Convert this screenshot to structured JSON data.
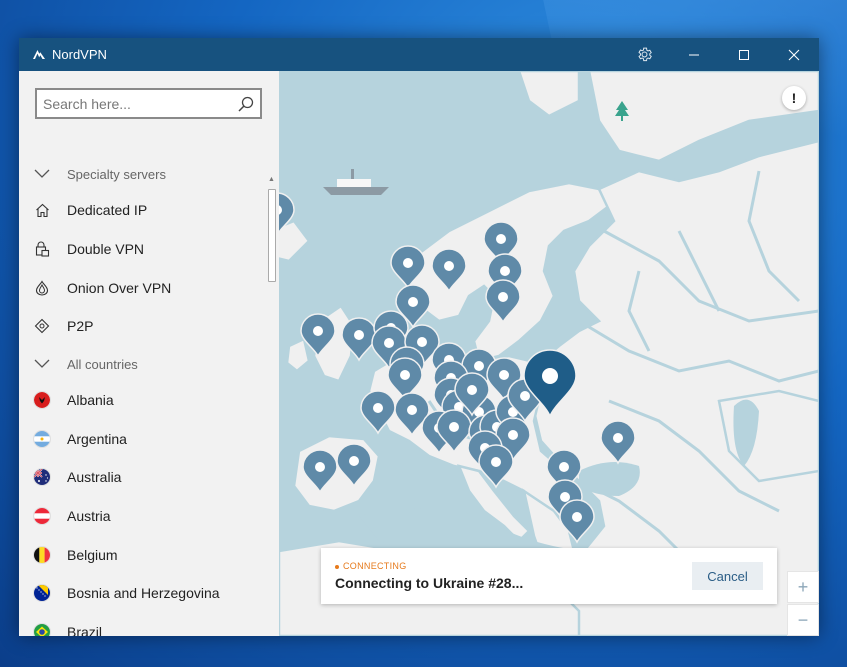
{
  "window": {
    "title": "NordVPN"
  },
  "titlebar": {
    "settings_icon": "gear-icon",
    "minimize_icon": "minimize-icon",
    "maximize_icon": "maximize-icon",
    "close_icon": "close-icon"
  },
  "search": {
    "placeholder": "Search here...",
    "value": ""
  },
  "sidebar": {
    "items": [
      {
        "label": "Specialty servers",
        "icon": "chevron-down-icon",
        "type": "header"
      },
      {
        "label": "Dedicated IP",
        "icon": "home-icon",
        "type": "item"
      },
      {
        "label": "Double VPN",
        "icon": "double-lock-icon",
        "type": "item"
      },
      {
        "label": "Onion Over VPN",
        "icon": "onion-icon",
        "type": "item"
      },
      {
        "label": "P2P",
        "icon": "p2p-icon",
        "type": "item"
      },
      {
        "label": "All countries",
        "icon": "chevron-down-icon",
        "type": "header"
      },
      {
        "label": "Albania",
        "icon": "flag-albania-icon",
        "type": "country"
      },
      {
        "label": "Argentina",
        "icon": "flag-argentina-icon",
        "type": "country"
      },
      {
        "label": "Australia",
        "icon": "flag-australia-icon",
        "type": "country"
      },
      {
        "label": "Austria",
        "icon": "flag-austria-icon",
        "type": "country"
      },
      {
        "label": "Belgium",
        "icon": "flag-belgium-icon",
        "type": "country"
      },
      {
        "label": "Bosnia and Herzegovina",
        "icon": "flag-bosnia-icon",
        "type": "country"
      },
      {
        "label": "Brazil",
        "icon": "flag-brazil-icon",
        "type": "country"
      }
    ]
  },
  "connection": {
    "status": "CONNECTING",
    "message": "Connecting to Ukraine #28...",
    "cancel_label": "Cancel"
  },
  "map": {
    "alert_label": "!",
    "zoom_in_label": "+",
    "zoom_out_label": "−"
  },
  "colors": {
    "titlebar": "#17527f",
    "sea": "#b6d3dd",
    "land": "#f0f0f0",
    "pin": "#5f8aa8",
    "active_pin": "#1f5d88",
    "accent_orange": "#e67a1c"
  }
}
